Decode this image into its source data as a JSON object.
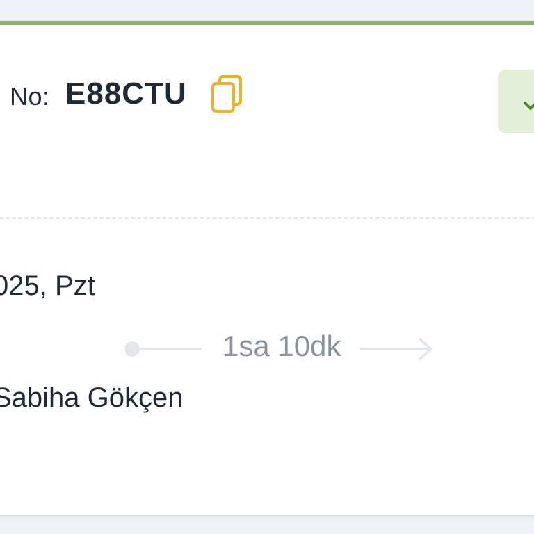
{
  "booking": {
    "pnr_label": "No:",
    "pnr_code": "E88CTU"
  },
  "icons": {
    "copy": "copy-icon",
    "check": "check-icon"
  },
  "flight": {
    "date_partial": "025, Pzt",
    "duration": "1sa 10dk",
    "departure_airport_partial": "Sabiha Gökçen"
  },
  "colors": {
    "accent_bar": "#8fae6e",
    "copy_icon": "#e8b425",
    "status_bg": "#e3f0d7",
    "check": "#4a8a2a",
    "text_dark": "#1f2937",
    "text_muted": "#8a939c"
  }
}
